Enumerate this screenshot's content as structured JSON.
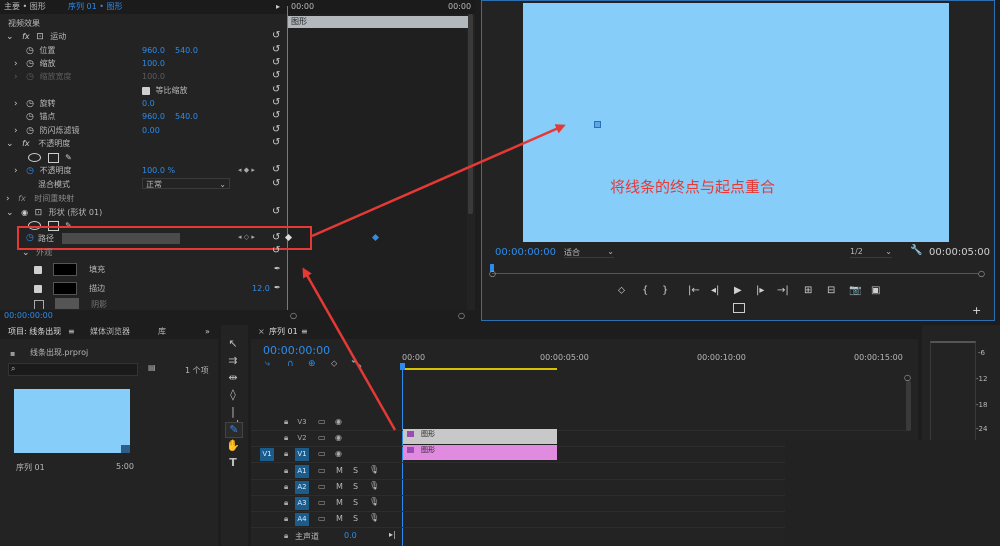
{
  "effect_controls": {
    "tab_master": "主要 • 图形",
    "tab_sequence": "序列 01 • 图形",
    "section_video": "视频效果",
    "clip_label": "图形",
    "time_start": "00:00",
    "time_end": "00:00",
    "current_time": "00:00:00:00",
    "fx_motion": "运动",
    "position_label": "位置",
    "position_x": "960.0",
    "position_y": "540.0",
    "scale_label": "缩放",
    "scale_value": "100.0",
    "scale_width_label": "缩放宽度",
    "scale_width_value": "100.0",
    "uniform_scale_label": "等比缩放",
    "rotation_label": "旋转",
    "rotation_value": "0.0",
    "anchor_label": "锚点",
    "anchor_x": "960.0",
    "anchor_y": "540.0",
    "antiflicker_label": "防闪烁滤镜",
    "antiflicker_value": "0.00",
    "fx_opacity": "不透明度",
    "opacity_label": "不透明度",
    "opacity_value": "100.0 %",
    "blend_label": "混合模式",
    "blend_value": "正常",
    "fx_time_remap": "时间重映射",
    "fx_shape": "形状 (形状 01)",
    "path_label": "路径",
    "appearance_label": "外观",
    "fill_label": "填充",
    "stroke_label": "描边",
    "stroke_value": "12.0",
    "shadow_label": "阴影"
  },
  "program_monitor": {
    "timecode": "00:00:00:00",
    "fit_label": "适合",
    "resolution": "1/2",
    "duration": "00:00:05:00",
    "annotation": "将线条的终点与起点重合",
    "preview_color": "#87cdfa"
  },
  "project_panel": {
    "tab_project": "项目: 线条出现",
    "tab_media": "媒体浏览器",
    "tab_library": "库",
    "file_name": "线条出现.prproj",
    "item_count": "1 个项",
    "thumb_name": "序列 01",
    "thumb_duration": "5:00",
    "thumb_color": "#87cdfa"
  },
  "timeline": {
    "tab_sequence": "序列 01",
    "timecode": "00:00:00:00",
    "ruler": [
      "00:00",
      "00:00:05:00",
      "00:00:10:00",
      "00:00:15:00"
    ],
    "tracks_video": [
      "V3",
      "V2",
      "V1"
    ],
    "tracks_audio": [
      "A1",
      "A2",
      "A3",
      "A4"
    ],
    "source_v": "V1",
    "master_label": "主声道",
    "master_value": "0.0",
    "mute_label": "M",
    "solo_label": "S",
    "clip_v2": "图形",
    "clip_v1": "图形",
    "clip_v2_color": "#c8c8c8",
    "clip_v1_color": "#e08ae0"
  },
  "meter": {
    "labels": [
      "-6",
      "-12",
      "-18",
      "-24"
    ]
  },
  "colors": {
    "accent_blue": "#2d8ceb",
    "highlight_red": "#e53935"
  }
}
